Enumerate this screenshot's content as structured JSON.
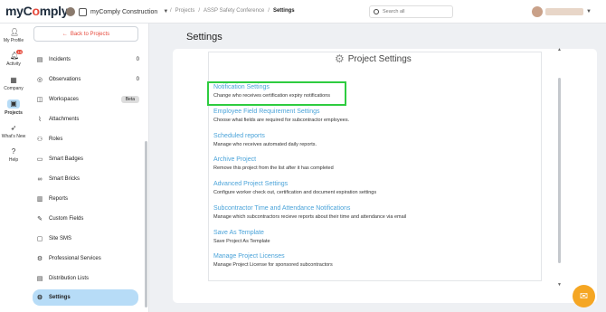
{
  "app": {
    "logo": "myComply"
  },
  "org": {
    "name": "myComply Construction"
  },
  "breadcrumb": {
    "sep": "/",
    "items": [
      "Projects",
      "ASSP Safety Conference"
    ],
    "current": "Settings"
  },
  "search": {
    "placeholder": "Search all"
  },
  "rail": [
    {
      "label": "My Profile",
      "icon": "person-icon"
    },
    {
      "label": "Activity",
      "icon": "bell-icon",
      "badge": "10"
    },
    {
      "label": "Company",
      "icon": "building-icon"
    },
    {
      "label": "Projects",
      "icon": "projects-icon"
    },
    {
      "label": "What's New",
      "icon": "rocket-icon"
    },
    {
      "label": "Help",
      "icon": "help-icon"
    }
  ],
  "menu": {
    "back_label": "Back to Projects",
    "items": [
      {
        "label": "Incidents",
        "icon": "incident-icon",
        "count": "0"
      },
      {
        "label": "Observations",
        "icon": "observation-icon",
        "count": "0"
      },
      {
        "label": "Workspaces",
        "icon": "workspace-icon",
        "badge": "Beta"
      },
      {
        "label": "Attachments",
        "icon": "paperclip-icon"
      },
      {
        "label": "Roles",
        "icon": "roles-icon"
      },
      {
        "label": "Smart Badges",
        "icon": "badge-icon"
      },
      {
        "label": "Smart Bricks",
        "icon": "bricks-icon"
      },
      {
        "label": "Reports",
        "icon": "reports-icon"
      },
      {
        "label": "Custom Fields",
        "icon": "custom-fields-icon"
      },
      {
        "label": "Site SMS",
        "icon": "sms-icon"
      },
      {
        "label": "Professional Services",
        "icon": "services-icon"
      },
      {
        "label": "Distribution Lists",
        "icon": "list-icon"
      },
      {
        "label": "Settings",
        "icon": "gear-icon"
      }
    ]
  },
  "main": {
    "title": "Settings",
    "panel_title": "Project Settings",
    "settings": [
      {
        "title": "Notification Settings",
        "desc": "Change who receives certification expiry notifications"
      },
      {
        "title": "Employee Field Requirement Settings",
        "desc": "Choose what fields are required for subcontractor employees."
      },
      {
        "title": "Scheduled reports",
        "desc": "Manage who receives automated daily reports."
      },
      {
        "title": "Archive Project",
        "desc": "Remove this project from the list after it has completed"
      },
      {
        "title": "Advanced Project Settings",
        "desc": "Configure worker check out, certification and document expiration settings"
      },
      {
        "title": "Subcontractor Time and Attendance Notifications",
        "desc": "Manage which subcontractors recieve reports about their time and attendance via email"
      },
      {
        "title": "Save As Template",
        "desc": "Save Project As Template"
      },
      {
        "title": "Manage Project Licenses",
        "desc": "Manage Project License for sponsored subcontractors"
      }
    ]
  },
  "colors": {
    "accent": "#4aa3d9",
    "brand": "#e64a3c",
    "active_bg": "#b7dcf7",
    "highlight": "#2ecc40",
    "chat": "#f5a623"
  }
}
